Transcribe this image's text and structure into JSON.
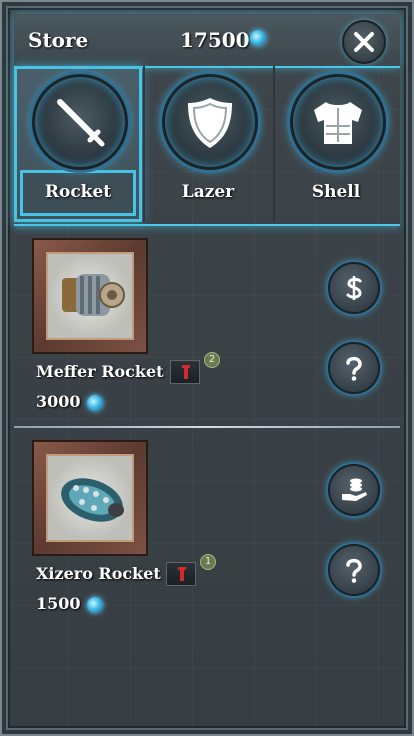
{
  "header": {
    "title": "Store",
    "coins": "17500",
    "coin_icon": "gem-icon",
    "close_icon": "close-icon"
  },
  "tabs": [
    {
      "label": "Rocket",
      "icon": "sword-icon",
      "active": true
    },
    {
      "label": "Lazer",
      "icon": "shield-icon",
      "active": false
    },
    {
      "label": "Shell",
      "icon": "armor-icon",
      "active": false
    }
  ],
  "items": [
    {
      "name": "Meffer Rocket",
      "price": "3000",
      "level": "2",
      "action_icon": "dollar-icon",
      "info_icon": "question-icon"
    },
    {
      "name": "Xizero Rocket",
      "price": "1500",
      "level": "1",
      "action_icon": "coins-in-hand-icon",
      "info_icon": "question-icon"
    }
  ],
  "colors": {
    "accent": "#4dc6e8",
    "panel": "#3a4247"
  }
}
